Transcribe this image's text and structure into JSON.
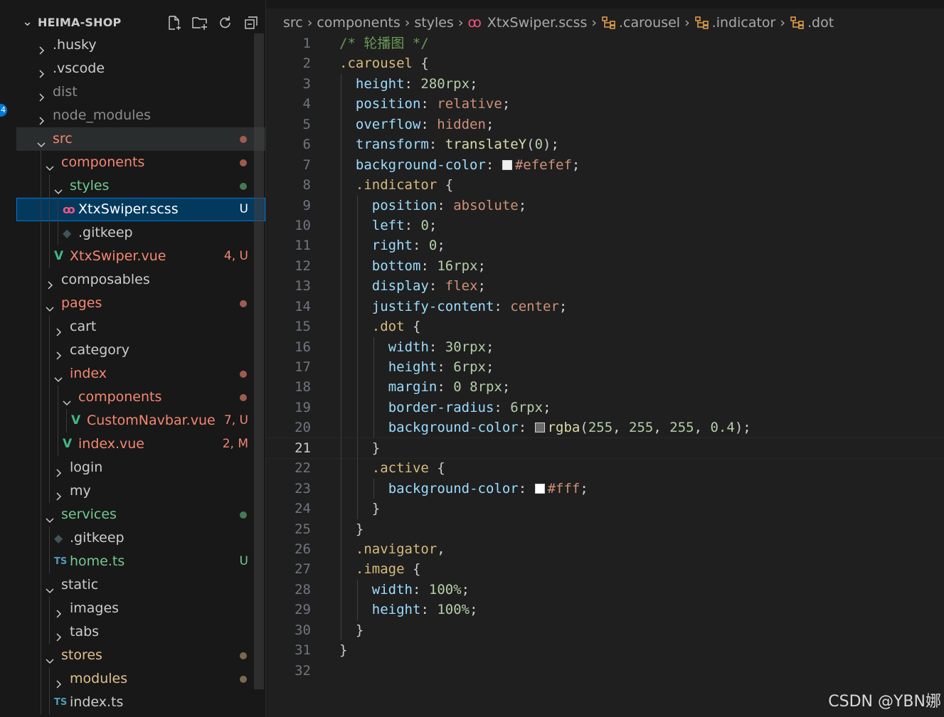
{
  "explorer": {
    "title": "HEIMA-SHOP",
    "actions": [
      "new-file-icon",
      "new-folder-icon",
      "refresh-icon",
      "collapse-all-icon"
    ],
    "badge": "4",
    "tree": [
      {
        "label": ".husky",
        "depth": 0,
        "type": "folder-closed",
        "color": "#cccccc"
      },
      {
        "label": ".vscode",
        "depth": 0,
        "type": "folder-closed",
        "color": "#cccccc"
      },
      {
        "label": "dist",
        "depth": 0,
        "type": "folder-closed",
        "color": "#8c8c8c"
      },
      {
        "label": "node_modules",
        "depth": 0,
        "type": "folder-closed",
        "color": "#8c8c8c"
      },
      {
        "label": "src",
        "depth": 0,
        "type": "folder-open",
        "color": "#f48771",
        "deco": "dot",
        "decoColor": "#9d5b52",
        "rowBg": "srcrow"
      },
      {
        "label": "components",
        "depth": 1,
        "type": "folder-open",
        "color": "#f48771",
        "deco": "dot",
        "decoColor": "#9d5b52"
      },
      {
        "label": "styles",
        "depth": 2,
        "type": "folder-open",
        "color": "#73c991",
        "deco": "dot",
        "decoColor": "#447a57"
      },
      {
        "label": "XtxSwiper.scss",
        "depth": 3,
        "type": "file",
        "icon": "sass-icon",
        "iconGlyph": "ꝏ",
        "iconColor": "#f55385",
        "color": "#ffffff",
        "deco": "U",
        "decoColor": "#ffffff",
        "rowBg": "sel"
      },
      {
        "label": ".gitkeep",
        "depth": 3,
        "type": "file",
        "icon": "git-icon",
        "iconGlyph": "◆",
        "iconColor": "#41535b",
        "color": "#cccccc"
      },
      {
        "label": "XtxSwiper.vue",
        "depth": 2,
        "type": "file",
        "icon": "vue-icon",
        "iconGlyph": "V",
        "iconColor": "#41b883",
        "color": "#f48771",
        "deco": "4, U",
        "decoColor": "#f48771"
      },
      {
        "label": "composables",
        "depth": 1,
        "type": "folder-closed",
        "color": "#cccccc"
      },
      {
        "label": "pages",
        "depth": 1,
        "type": "folder-open",
        "color": "#f48771",
        "deco": "dot",
        "decoColor": "#9d5b52"
      },
      {
        "label": "cart",
        "depth": 2,
        "type": "folder-closed",
        "color": "#cccccc"
      },
      {
        "label": "category",
        "depth": 2,
        "type": "folder-closed",
        "color": "#cccccc"
      },
      {
        "label": "index",
        "depth": 2,
        "type": "folder-open",
        "color": "#f48771",
        "deco": "dot",
        "decoColor": "#9d5b52"
      },
      {
        "label": "components",
        "depth": 3,
        "type": "folder-open",
        "color": "#f48771",
        "deco": "dot",
        "decoColor": "#9d5b52"
      },
      {
        "label": "CustomNavbar.vue",
        "depth": 4,
        "type": "file",
        "icon": "vue-icon",
        "iconGlyph": "V",
        "iconColor": "#41b883",
        "color": "#f48771",
        "deco": "7, U",
        "decoColor": "#f48771"
      },
      {
        "label": "index.vue",
        "depth": 3,
        "type": "file",
        "icon": "vue-icon",
        "iconGlyph": "V",
        "iconColor": "#41b883",
        "color": "#f48771",
        "deco": "2, M",
        "decoColor": "#f48771"
      },
      {
        "label": "login",
        "depth": 2,
        "type": "folder-closed",
        "color": "#cccccc"
      },
      {
        "label": "my",
        "depth": 2,
        "type": "folder-closed",
        "color": "#cccccc"
      },
      {
        "label": "services",
        "depth": 1,
        "type": "folder-open",
        "color": "#73c991",
        "deco": "dot",
        "decoColor": "#447a57"
      },
      {
        "label": ".gitkeep",
        "depth": 2,
        "type": "file",
        "icon": "git-icon",
        "iconGlyph": "◆",
        "iconColor": "#41535b",
        "color": "#cccccc"
      },
      {
        "label": "home.ts",
        "depth": 2,
        "type": "file",
        "icon": "typescript-icon",
        "iconGlyph": "TS",
        "iconColor": "#519aba",
        "color": "#73c991",
        "deco": "U",
        "decoColor": "#73c991"
      },
      {
        "label": "static",
        "depth": 1,
        "type": "folder-open",
        "color": "#cccccc"
      },
      {
        "label": "images",
        "depth": 2,
        "type": "folder-closed",
        "color": "#cccccc"
      },
      {
        "label": "tabs",
        "depth": 2,
        "type": "folder-closed",
        "color": "#cccccc"
      },
      {
        "label": "stores",
        "depth": 1,
        "type": "folder-open",
        "color": "#e2c08d",
        "deco": "dot",
        "decoColor": "#7a6a4d"
      },
      {
        "label": "modules",
        "depth": 2,
        "type": "folder-closed",
        "color": "#e2c08d",
        "deco": "dot",
        "decoColor": "#7a6a4d"
      },
      {
        "label": "index.ts",
        "depth": 2,
        "type": "file",
        "icon": "typescript-icon",
        "iconGlyph": "TS",
        "iconColor": "#519aba",
        "color": "#cccccc"
      }
    ]
  },
  "breadcrumb": [
    {
      "label": "src",
      "icon": ""
    },
    {
      "label": "components",
      "icon": ""
    },
    {
      "label": "styles",
      "icon": ""
    },
    {
      "label": "XtxSwiper.scss",
      "icon": "sass-icon"
    },
    {
      "label": ".carousel",
      "icon": "selector-icon"
    },
    {
      "label": ".indicator",
      "icon": "selector-icon"
    },
    {
      "label": ".dot",
      "icon": "selector-icon"
    }
  ],
  "editor": {
    "currentLine": 21,
    "lines": [
      {
        "n": "1",
        "ind": 0,
        "t": [
          [
            "/* 轮播图 */",
            "com"
          ]
        ]
      },
      {
        "n": "2",
        "ind": 0,
        "t": [
          [
            ".carousel ",
            "sel"
          ],
          [
            "{",
            "b1"
          ]
        ]
      },
      {
        "n": "3",
        "ind": 1,
        "t": [
          [
            "height",
            "prop"
          ],
          [
            ": ",
            "p"
          ],
          [
            "280rpx",
            "num"
          ],
          [
            ";",
            "p"
          ]
        ]
      },
      {
        "n": "4",
        "ind": 1,
        "t": [
          [
            "position",
            "prop"
          ],
          [
            ": ",
            "p"
          ],
          [
            "relative",
            "val"
          ],
          [
            ";",
            "p"
          ]
        ]
      },
      {
        "n": "5",
        "ind": 1,
        "t": [
          [
            "overflow",
            "prop"
          ],
          [
            ": ",
            "p"
          ],
          [
            "hidden",
            "val"
          ],
          [
            ";",
            "p"
          ]
        ]
      },
      {
        "n": "6",
        "ind": 1,
        "t": [
          [
            "transform",
            "prop"
          ],
          [
            ": ",
            "p"
          ],
          [
            "translateY",
            "fn"
          ],
          [
            "(",
            "b2"
          ],
          [
            "0",
            "num"
          ],
          [
            ")",
            "b2"
          ],
          [
            ";",
            "p"
          ]
        ]
      },
      {
        "n": "7",
        "ind": 1,
        "t": [
          [
            "background-color",
            "prop"
          ],
          [
            ": ",
            "p"
          ],
          [
            "#efefef",
            "swatch"
          ],
          [
            "#efefef",
            "val"
          ],
          [
            ";",
            "p"
          ]
        ]
      },
      {
        "n": "8",
        "ind": 1,
        "t": [
          [
            ".indicator ",
            "sel"
          ],
          [
            "{",
            "b2"
          ]
        ]
      },
      {
        "n": "9",
        "ind": 2,
        "t": [
          [
            "position",
            "prop"
          ],
          [
            ": ",
            "p"
          ],
          [
            "absolute",
            "val"
          ],
          [
            ";",
            "p"
          ]
        ]
      },
      {
        "n": "10",
        "ind": 2,
        "t": [
          [
            "left",
            "prop"
          ],
          [
            ": ",
            "p"
          ],
          [
            "0",
            "num"
          ],
          [
            ";",
            "p"
          ]
        ]
      },
      {
        "n": "11",
        "ind": 2,
        "t": [
          [
            "right",
            "prop"
          ],
          [
            ": ",
            "p"
          ],
          [
            "0",
            "num"
          ],
          [
            ";",
            "p"
          ]
        ]
      },
      {
        "n": "12",
        "ind": 2,
        "t": [
          [
            "bottom",
            "prop"
          ],
          [
            ": ",
            "p"
          ],
          [
            "16rpx",
            "num"
          ],
          [
            ";",
            "p"
          ]
        ]
      },
      {
        "n": "13",
        "ind": 2,
        "t": [
          [
            "display",
            "prop"
          ],
          [
            ": ",
            "p"
          ],
          [
            "flex",
            "val"
          ],
          [
            ";",
            "p"
          ]
        ]
      },
      {
        "n": "14",
        "ind": 2,
        "t": [
          [
            "justify-content",
            "prop"
          ],
          [
            ": ",
            "p"
          ],
          [
            "center",
            "val"
          ],
          [
            ";",
            "p"
          ]
        ]
      },
      {
        "n": "15",
        "ind": 2,
        "t": [
          [
            ".dot ",
            "sel"
          ],
          [
            "{",
            "b3"
          ]
        ]
      },
      {
        "n": "16",
        "ind": 3,
        "t": [
          [
            "width",
            "prop"
          ],
          [
            ": ",
            "p"
          ],
          [
            "30rpx",
            "num"
          ],
          [
            ";",
            "p"
          ]
        ]
      },
      {
        "n": "17",
        "ind": 3,
        "t": [
          [
            "height",
            "prop"
          ],
          [
            ": ",
            "p"
          ],
          [
            "6rpx",
            "num"
          ],
          [
            ";",
            "p"
          ]
        ]
      },
      {
        "n": "18",
        "ind": 3,
        "t": [
          [
            "margin",
            "prop"
          ],
          [
            ": ",
            "p"
          ],
          [
            "0",
            "num"
          ],
          [
            " ",
            "p"
          ],
          [
            "8rpx",
            "num"
          ],
          [
            ";",
            "p"
          ]
        ]
      },
      {
        "n": "19",
        "ind": 3,
        "t": [
          [
            "border-radius",
            "prop"
          ],
          [
            ": ",
            "p"
          ],
          [
            "6rpx",
            "num"
          ],
          [
            ";",
            "p"
          ]
        ]
      },
      {
        "n": "20",
        "ind": 3,
        "t": [
          [
            "background-color",
            "prop"
          ],
          [
            ": ",
            "p"
          ],
          [
            "rgba(255,255,255,0.4)",
            "swatch"
          ],
          [
            "rgba",
            "fn"
          ],
          [
            "(",
            "b1"
          ],
          [
            "255",
            "num"
          ],
          [
            ", ",
            "p"
          ],
          [
            "255",
            "num"
          ],
          [
            ", ",
            "p"
          ],
          [
            "255",
            "num"
          ],
          [
            ", ",
            "p"
          ],
          [
            "0.4",
            "num"
          ],
          [
            ")",
            "b1"
          ],
          [
            ";",
            "p"
          ]
        ]
      },
      {
        "n": "21",
        "ind": 2,
        "t": [
          [
            "}",
            "b3"
          ]
        ]
      },
      {
        "n": "22",
        "ind": 2,
        "t": [
          [
            ".active ",
            "sel"
          ],
          [
            "{",
            "b3"
          ]
        ]
      },
      {
        "n": "23",
        "ind": 3,
        "t": [
          [
            "background-color",
            "prop"
          ],
          [
            ": ",
            "p"
          ],
          [
            "#fff",
            "swatch"
          ],
          [
            "#fff",
            "val"
          ],
          [
            ";",
            "p"
          ]
        ]
      },
      {
        "n": "24",
        "ind": 2,
        "t": [
          [
            "}",
            "b3"
          ]
        ]
      },
      {
        "n": "25",
        "ind": 1,
        "t": [
          [
            "}",
            "b2"
          ]
        ]
      },
      {
        "n": "26",
        "ind": 1,
        "t": [
          [
            ".navigator",
            "sel"
          ],
          [
            ",",
            "p"
          ]
        ]
      },
      {
        "n": "27",
        "ind": 1,
        "t": [
          [
            ".image ",
            "sel"
          ],
          [
            "{",
            "b2"
          ]
        ]
      },
      {
        "n": "28",
        "ind": 2,
        "t": [
          [
            "width",
            "prop"
          ],
          [
            ": ",
            "p"
          ],
          [
            "100%",
            "num"
          ],
          [
            ";",
            "p"
          ]
        ]
      },
      {
        "n": "29",
        "ind": 2,
        "t": [
          [
            "height",
            "prop"
          ],
          [
            ": ",
            "p"
          ],
          [
            "100%",
            "num"
          ],
          [
            ";",
            "p"
          ]
        ]
      },
      {
        "n": "30",
        "ind": 1,
        "t": [
          [
            "}",
            "b2"
          ]
        ]
      },
      {
        "n": "31",
        "ind": 0,
        "t": [
          [
            "}",
            "b1"
          ]
        ]
      },
      {
        "n": "32",
        "ind": 0,
        "t": []
      }
    ]
  },
  "watermark": "CSDN @YBN娜"
}
